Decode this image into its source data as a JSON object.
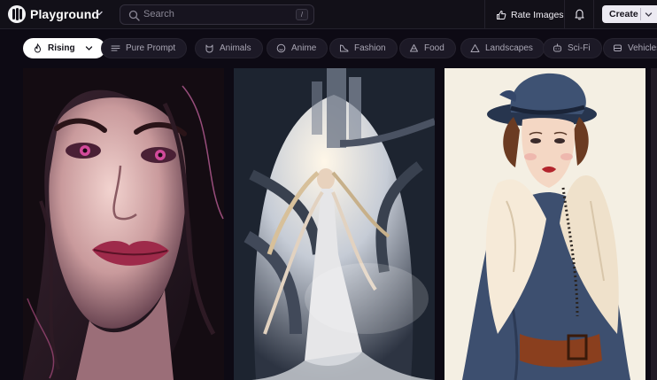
{
  "header": {
    "brand": "Playground",
    "search_placeholder": "Search",
    "search_shortcut": "/",
    "rate_images_label": "Rate Images",
    "create_label": "Create"
  },
  "filters": [
    {
      "label": "Rising",
      "icon": "flame-icon",
      "active": true
    },
    {
      "label": "Pure Prompt",
      "icon": "lines-icon",
      "active": false
    },
    {
      "label": "Animals",
      "icon": "animal-icon",
      "active": false
    },
    {
      "label": "Anime",
      "icon": "smile-icon",
      "active": false
    },
    {
      "label": "Fashion",
      "icon": "shoe-icon",
      "active": false
    },
    {
      "label": "Food",
      "icon": "food-icon",
      "active": false
    },
    {
      "label": "Landscapes",
      "icon": "mountain-icon",
      "active": false
    },
    {
      "label": "Sci-Fi",
      "icon": "robot-icon",
      "active": false
    },
    {
      "label": "Vehicles",
      "icon": "car-icon",
      "active": false
    }
  ],
  "gallery": {
    "images": [
      {
        "subject": "portrait-dark-hair-pink-eyes"
      },
      {
        "subject": "woman-white-dress-futuristic-city"
      },
      {
        "subject": "vintage-woman-cloche-hat-fur-coat"
      }
    ]
  },
  "colors": {
    "background": "#0d0a14",
    "topbar": "#121018",
    "chip": "#1c1926",
    "chip_active": "#ffffff",
    "create_button": "#eceaf2"
  }
}
